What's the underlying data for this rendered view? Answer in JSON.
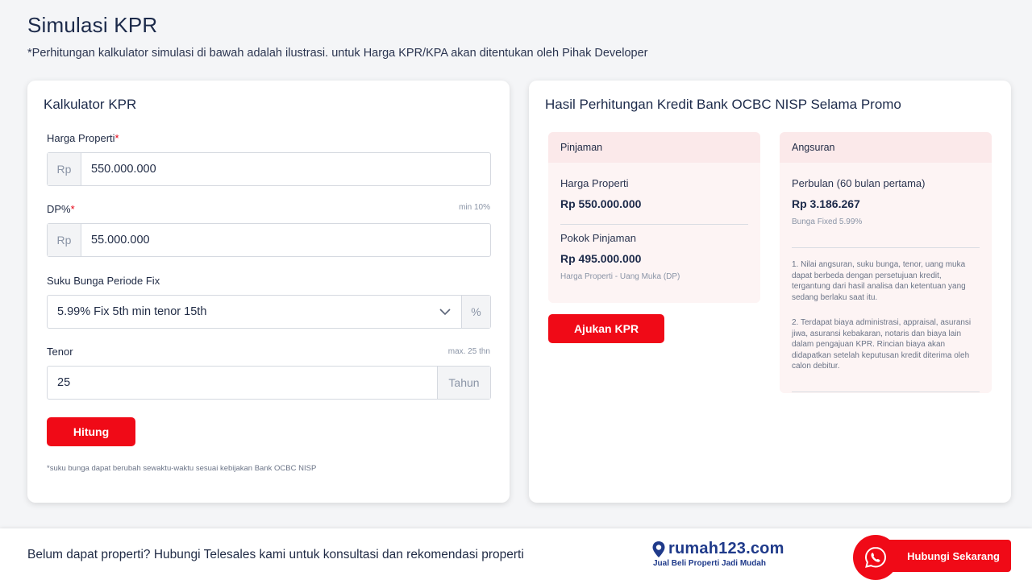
{
  "page": {
    "title": "Simulasi KPR",
    "subtitle": "*Perhitungan kalkulator simulasi di bawah adalah ilustrasi. untuk Harga KPR/KPA akan ditentukan oleh Pihak Developer"
  },
  "calculator": {
    "title": "Kalkulator KPR",
    "price": {
      "label": "Harga Properti",
      "required": "*",
      "prefix": "Rp",
      "value": "550.000.000"
    },
    "dp": {
      "label": "DP%",
      "required": "*",
      "hint": "min 10%",
      "prefix": "Rp",
      "value": "55.000.000"
    },
    "rate": {
      "label": "Suku Bunga Periode Fix",
      "selected": "5.99% Fix 5th min tenor 15th",
      "suffix": "%"
    },
    "tenor": {
      "label": "Tenor",
      "hint": "max. 25 thn",
      "value": "25",
      "suffix": "Tahun"
    },
    "calculate_button": "Hitung",
    "footnote": "*suku bunga dapat berubah sewaktu-waktu sesuai kebijakan Bank OCBC NISP"
  },
  "result": {
    "title": "Hasil Perhitungan Kredit Bank OCBC NISP Selama Promo",
    "loan": {
      "header": "Pinjaman",
      "price_label": "Harga Properti",
      "price_value": "Rp 550.000.000",
      "principal_label": "Pokok Pinjaman",
      "principal_value": "Rp 495.000.000",
      "principal_note": "Harga Properti - Uang Muka (DP)"
    },
    "installment": {
      "header": "Angsuran",
      "monthly_label": "Perbulan (60 bulan pertama)",
      "monthly_value": "Rp 3.186.267",
      "rate_note": "Bunga Fixed 5.99%",
      "note1": "1. Nilai angsuran, suku bunga, tenor, uang muka dapat berbeda dengan persetujuan kredit, tergantung dari hasil analisa dan ketentuan yang sedang berlaku saat itu.",
      "note2": "2. Terdapat biaya administrasi, appraisal, asuransi jiwa, asuransi kebakaran, notaris dan biaya lain dalam pengajuan KPR. Rincian biaya akan didapatkan setelah keputusan kredit diterima oleh calon debitur."
    },
    "apply_button": "Ajukan KPR"
  },
  "bottom_bar": {
    "text": "Belum dapat properti? Hubungi Telesales kami untuk konsultasi dan rekomendasi properti",
    "brand_name": "rumah123.com",
    "brand_tagline": "Jual Beli Properti Jadi Mudah",
    "contact_button": "Hubungi Sekarang"
  },
  "colors": {
    "accent": "#f00a17",
    "brand": "#1f3a8a",
    "panel_bg": "#fdf4f4"
  },
  "icons": [
    "chevron-down-icon",
    "location-pin-icon",
    "whatsapp-icon"
  ]
}
